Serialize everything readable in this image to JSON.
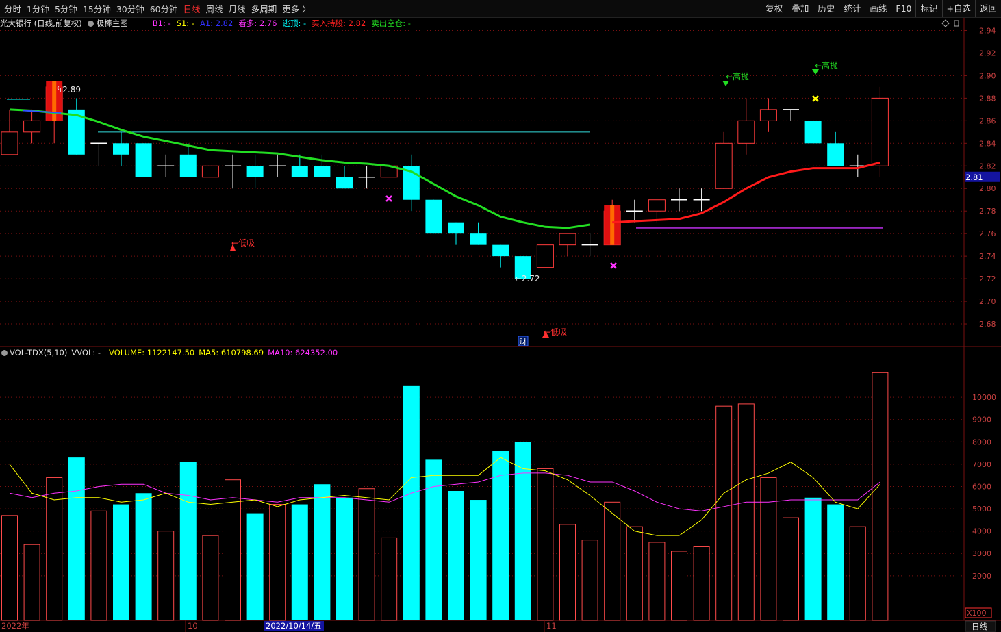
{
  "toolbar": {
    "periods": [
      {
        "label": "分时",
        "active": false
      },
      {
        "label": "1分钟",
        "active": false
      },
      {
        "label": "5分钟",
        "active": false
      },
      {
        "label": "15分钟",
        "active": false
      },
      {
        "label": "30分钟",
        "active": false
      },
      {
        "label": "60分钟",
        "active": false
      },
      {
        "label": "日线",
        "active": true
      },
      {
        "label": "周线",
        "active": false
      },
      {
        "label": "月线",
        "active": false
      },
      {
        "label": "多周期",
        "active": false
      },
      {
        "label": "更多 〉",
        "active": false
      }
    ],
    "right_buttons": [
      "复权",
      "叠加",
      "历史",
      "统计",
      "画线",
      "F10",
      "标记",
      "+自选",
      "返回"
    ]
  },
  "header": {
    "stock_title": "光大银行 (日线,前复权)",
    "indicator": "极棒主图",
    "b1": "B1: -",
    "s1": "S1: -",
    "a1": "A1: 2.82",
    "kanduo": "看多: 2.76",
    "taoding": "逃顶: -",
    "buy_hold": "买入持股: 2.82",
    "sell_empty": "卖出空仓: -"
  },
  "vol_header": {
    "name": "VOL-TDX(5,10)",
    "vvol": "VVOL: -",
    "volume": "VOLUME: 1122147.50",
    "ma5": "MA5: 610798.69",
    "ma10": "MA10: 624352.00"
  },
  "colors": {
    "up": "#ff3b3b",
    "down": "#00ffff",
    "ma_green": "#22dd22",
    "ma_red": "#ff1a1a",
    "vol_ma5": "#ffff00",
    "vol_ma10": "#ff33ff",
    "grid": "#7a1010",
    "price_tag": "#1414a0"
  },
  "chart_data": {
    "type": "candlestick",
    "price_axis": {
      "ticks": [
        "2.94",
        "2.92",
        "2.90",
        "2.88",
        "2.86",
        "2.84",
        "2.82",
        "2.80",
        "2.78",
        "2.76",
        "2.74",
        "2.72",
        "2.70",
        "2.68"
      ],
      "range": [
        2.66,
        2.95
      ],
      "current": "2.81"
    },
    "volume_axis": {
      "ticks": [
        "10000",
        "9000",
        "8000",
        "7000",
        "6000",
        "5000",
        "4000",
        "3000",
        "2000"
      ],
      "unit": "X100",
      "range": [
        0,
        11600
      ]
    },
    "date_labels": [
      "2022年",
      "10",
      "2022/10/14/五",
      "11"
    ],
    "period_label": "日线",
    "candles": [
      {
        "o": 2.83,
        "h": 2.87,
        "l": 2.83,
        "c": 2.85
      },
      {
        "o": 2.85,
        "h": 2.87,
        "l": 2.84,
        "c": 2.86
      },
      {
        "o": 2.86,
        "h": 2.89,
        "l": 2.84,
        "c": 2.89
      },
      {
        "o": 2.87,
        "h": 2.88,
        "l": 2.83,
        "c": 2.83
      },
      {
        "o": 2.84,
        "h": 2.84,
        "l": 2.82,
        "c": 2.84
      },
      {
        "o": 2.84,
        "h": 2.85,
        "l": 2.82,
        "c": 2.83
      },
      {
        "o": 2.84,
        "h": 2.84,
        "l": 2.81,
        "c": 2.81
      },
      {
        "o": 2.82,
        "h": 2.83,
        "l": 2.81,
        "c": 2.82
      },
      {
        "o": 2.83,
        "h": 2.84,
        "l": 2.81,
        "c": 2.81
      },
      {
        "o": 2.81,
        "h": 2.82,
        "l": 2.81,
        "c": 2.82
      },
      {
        "o": 2.82,
        "h": 2.83,
        "l": 2.8,
        "c": 2.82
      },
      {
        "o": 2.82,
        "h": 2.83,
        "l": 2.8,
        "c": 2.81
      },
      {
        "o": 2.82,
        "h": 2.83,
        "l": 2.81,
        "c": 2.82
      },
      {
        "o": 2.82,
        "h": 2.83,
        "l": 2.81,
        "c": 2.81
      },
      {
        "o": 2.82,
        "h": 2.83,
        "l": 2.81,
        "c": 2.81
      },
      {
        "o": 2.81,
        "h": 2.82,
        "l": 2.8,
        "c": 2.8
      },
      {
        "o": 2.81,
        "h": 2.82,
        "l": 2.8,
        "c": 2.81
      },
      {
        "o": 2.81,
        "h": 2.82,
        "l": 2.81,
        "c": 2.82
      },
      {
        "o": 2.82,
        "h": 2.83,
        "l": 2.78,
        "c": 2.79
      },
      {
        "o": 2.79,
        "h": 2.79,
        "l": 2.76,
        "c": 2.76
      },
      {
        "o": 2.77,
        "h": 2.77,
        "l": 2.75,
        "c": 2.76
      },
      {
        "o": 2.76,
        "h": 2.77,
        "l": 2.75,
        "c": 2.75
      },
      {
        "o": 2.75,
        "h": 2.75,
        "l": 2.73,
        "c": 2.74
      },
      {
        "o": 2.74,
        "h": 2.74,
        "l": 2.72,
        "c": 2.72
      },
      {
        "o": 2.73,
        "h": 2.75,
        "l": 2.73,
        "c": 2.75
      },
      {
        "o": 2.75,
        "h": 2.76,
        "l": 2.74,
        "c": 2.76
      },
      {
        "o": 2.75,
        "h": 2.76,
        "l": 2.74,
        "c": 2.75
      },
      {
        "o": 2.75,
        "h": 2.79,
        "l": 2.75,
        "c": 2.78
      },
      {
        "o": 2.78,
        "h": 2.79,
        "l": 2.77,
        "c": 2.78
      },
      {
        "o": 2.78,
        "h": 2.79,
        "l": 2.77,
        "c": 2.79
      },
      {
        "o": 2.79,
        "h": 2.8,
        "l": 2.78,
        "c": 2.79
      },
      {
        "o": 2.79,
        "h": 2.8,
        "l": 2.78,
        "c": 2.79
      },
      {
        "o": 2.8,
        "h": 2.85,
        "l": 2.8,
        "c": 2.84
      },
      {
        "o": 2.84,
        "h": 2.88,
        "l": 2.83,
        "c": 2.86
      },
      {
        "o": 2.86,
        "h": 2.88,
        "l": 2.85,
        "c": 2.87
      },
      {
        "o": 2.87,
        "h": 2.87,
        "l": 2.86,
        "c": 2.87
      },
      {
        "o": 2.86,
        "h": 2.86,
        "l": 2.84,
        "c": 2.84
      },
      {
        "o": 2.84,
        "h": 2.85,
        "l": 2.82,
        "c": 2.82
      },
      {
        "o": 2.82,
        "h": 2.83,
        "l": 2.81,
        "c": 2.82
      },
      {
        "o": 2.82,
        "h": 2.89,
        "l": 2.81,
        "c": 2.88
      }
    ],
    "volumes": [
      4700,
      3400,
      6400,
      7300,
      4900,
      5200,
      5700,
      4000,
      7100,
      3800,
      6300,
      4800,
      5200,
      5200,
      6100,
      5500,
      5900,
      3700,
      10500,
      7200,
      5800,
      5400,
      7600,
      8000,
      6800,
      4300,
      3600,
      5300,
      4200,
      3500,
      3100,
      3300,
      9600,
      9700,
      6400,
      4600,
      5500,
      5200,
      4200,
      11100
    ],
    "vol_ma5": [
      7000,
      5700,
      5400,
      5500,
      5500,
      5300,
      5400,
      5700,
      5300,
      5200,
      5300,
      5400,
      5100,
      5400,
      5500,
      5600,
      5500,
      5400,
      6400,
      6500,
      6500,
      6500,
      7300,
      6800,
      6700,
      6300,
      5600,
      4800,
      4000,
      3800,
      3800,
      4500,
      5700,
      6300,
      6600,
      7100,
      6400,
      5300,
      5000,
      6100
    ],
    "vol_ma10": [
      5700,
      5500,
      5700,
      5800,
      6000,
      6100,
      6100,
      5700,
      5600,
      5400,
      5500,
      5400,
      5300,
      5500,
      5500,
      5500,
      5400,
      5300,
      5700,
      6000,
      6100,
      6200,
      6500,
      6600,
      6600,
      6500,
      6200,
      6200,
      5800,
      5300,
      5000,
      4900,
      5100,
      5300,
      5300,
      5400,
      5400,
      5400,
      5400,
      6200
    ],
    "ma_line": [
      2.87,
      2.869,
      2.867,
      2.865,
      2.859,
      2.852,
      2.846,
      2.842,
      2.838,
      2.834,
      2.833,
      2.832,
      2.831,
      2.828,
      2.825,
      2.823,
      2.822,
      2.82,
      2.815,
      2.804,
      2.793,
      2.785,
      2.775,
      2.77,
      2.766,
      2.765,
      2.768,
      2.77,
      2.771,
      2.772,
      2.773,
      2.778,
      2.788,
      2.8,
      2.81,
      2.815,
      2.818,
      2.818,
      2.818,
      2.823
    ],
    "annotations": {
      "high_label": "2.89",
      "low_label": "2.72",
      "high_arrow_prefix": "↰",
      "low_arrow_prefix": "←",
      "buy_signal": "←低吸",
      "sell_signal": "←高抛",
      "finance_marker": "财"
    }
  }
}
